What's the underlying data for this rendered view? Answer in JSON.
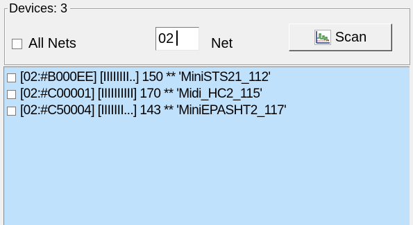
{
  "devices_group": {
    "title": "Devices: 3"
  },
  "controls": {
    "all_nets": {
      "label": "All Nets",
      "checked": false
    },
    "net_input": {
      "value": "02"
    },
    "net_label": "Net",
    "scan_button": {
      "label": "Scan",
      "icon": "chart-icon"
    }
  },
  "device_list": {
    "background": "#bfe1fb",
    "items": [
      {
        "checked": false,
        "text": "[02:#B000EE] [IIIIIIII..] 150 ** 'MiniSTS21_112'"
      },
      {
        "checked": false,
        "text": "[02:#C00001] [IIIIIIIIII] 170 ** 'Midi_HC2_115'"
      },
      {
        "checked": false,
        "text": "[02:#C50004] [IIIIIII...] 143 ** 'MiniEPASHT2_117'"
      }
    ]
  }
}
